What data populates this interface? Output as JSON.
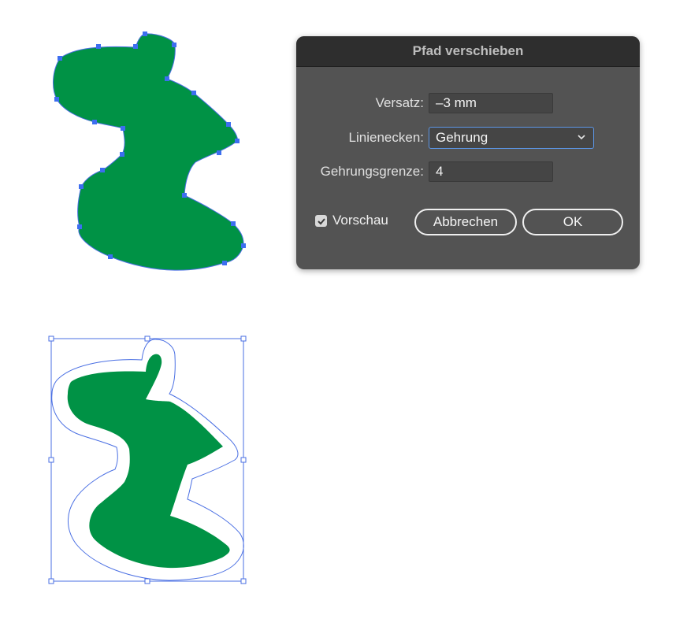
{
  "dialog": {
    "title": "Pfad verschieben",
    "offset_label": "Versatz:",
    "offset_value": "–3 mm",
    "joins_label": "Linienecken:",
    "joins_value": "Gehrung",
    "miter_label": "Gehrungsgrenze:",
    "miter_value": "4",
    "preview_label": "Vorschau",
    "preview_checked": true,
    "cancel_label": "Abbrechen",
    "ok_label": "OK"
  },
  "colors": {
    "shape_fill": "#009245",
    "path_stroke": "#4a6fe3",
    "anchor": "#3d6ef0",
    "dialog_bg": "#535353",
    "titlebar_bg": "#2e2e2e",
    "select_border": "#5c96e6"
  },
  "icons": {
    "dropdown": "chevron-down-icon",
    "checkbox": "checkmark-icon"
  }
}
